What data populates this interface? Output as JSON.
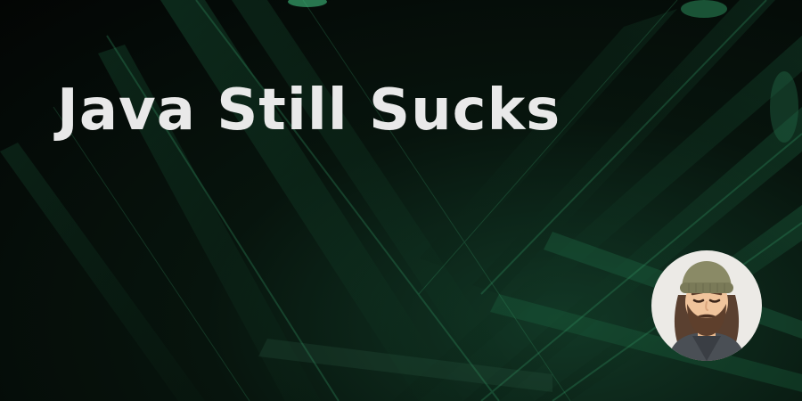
{
  "banner": {
    "title": "Java Still Sucks",
    "background_theme": "dark green palm leaves",
    "title_color": "#e9e9e9",
    "accent_color": "#1f6e47"
  },
  "avatar": {
    "icon": "memoji-bearded-man-beanie-icon",
    "background_color": "#eceae6"
  }
}
